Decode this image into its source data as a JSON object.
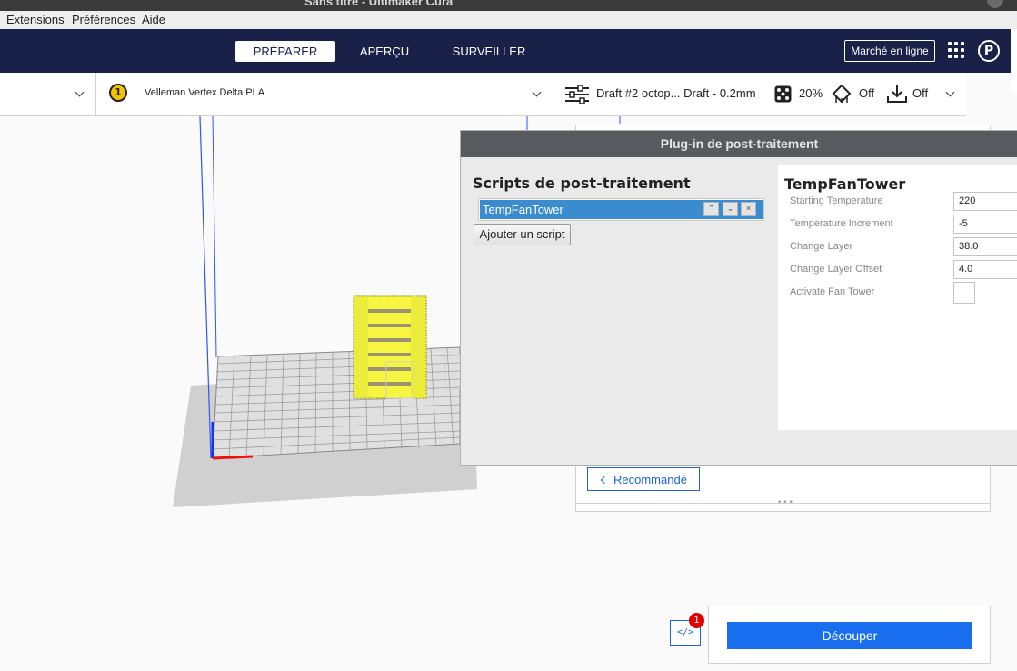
{
  "window": {
    "title": "Sans titre - Ultimaker Cura"
  },
  "menubar": {
    "items": [
      "Extensions",
      "Préférences",
      "Aide"
    ],
    "mnemonics": [
      "x",
      "P",
      "A"
    ]
  },
  "stages": {
    "tabs": [
      {
        "label": "PRÉPARER",
        "active": true
      },
      {
        "label": "APERÇU",
        "active": false
      },
      {
        "label": "SURVEILLER",
        "active": false
      }
    ],
    "marketplace_label": "Marché en ligne",
    "profile_initial": "P"
  },
  "printer_bar": {
    "extruder_number": "1",
    "material": "Velleman Vertex Delta PLA",
    "profile": "Draft #2 octop... Draft - 0.2mm",
    "infill": "20%",
    "support": "Off",
    "adhesion": "Off"
  },
  "dialog": {
    "title": "Plug-in de post-traitement",
    "scripts_heading": "Scripts de post-traitement",
    "scripts": [
      "TempFanTower"
    ],
    "add_script_label": "Ajouter un script",
    "settings_heading": "TempFanTower",
    "settings": [
      {
        "label": "Starting Temperature",
        "value": "220"
      },
      {
        "label": "Temperature Increment",
        "value": "-5"
      },
      {
        "label": "Change Layer",
        "value": "38.0"
      },
      {
        "label": "Change Layer Offset",
        "value": "4.0"
      }
    ],
    "fan_tower_label": "Activate Fan Tower",
    "fan_tower_checked": false
  },
  "print_settings_panel": {
    "recommended_label": "Recommandé"
  },
  "slice": {
    "button_label": "Découper",
    "notification_count": "1"
  },
  "colors": {
    "topbar": "#192148",
    "accent": "#196ef0",
    "selection": "#3b8bd0",
    "model": "#f5f542"
  }
}
